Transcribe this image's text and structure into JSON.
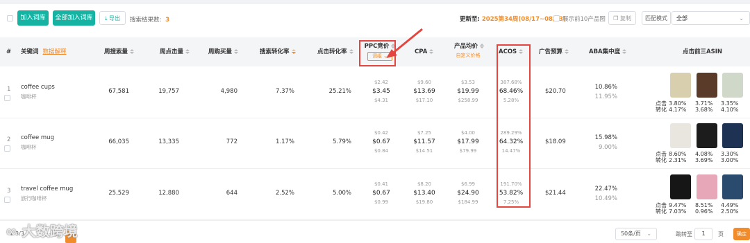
{
  "toolbar": {
    "add_to_lexicon": "加入词库",
    "add_all_to_lexicon": "全部加入词库",
    "export": "导出",
    "results_label": "搜索结果数:",
    "results_count": "3",
    "updated_label": "更新至:",
    "updated_value": "2025第34周(08/17~08/23)",
    "show_top10": "展示前10产品图",
    "copy": "复制",
    "match_mode_label": "匹配模式",
    "match_mode_value": "全部"
  },
  "columns": {
    "index": "#",
    "keyword": "关键词",
    "keyword_link": "数据解释",
    "weekly_searches": "周搜索量",
    "weekly_clicks": "周点击量",
    "weekly_purchases": "周购买量",
    "search_conversion": "搜索转化率",
    "click_conversion": "点击转化率",
    "ppc_bid": "PPC竞价",
    "ppc_sub_button": "词组",
    "cpa": "CPA",
    "avg_price": "产品均价",
    "avg_price_link": "自定义价格",
    "acos": "ACOS",
    "ad_budget": "广告预算",
    "aba_concentration": "ABA集中度",
    "top3_asin": "点击前三ASIN"
  },
  "rows": [
    {
      "index": "1",
      "keyword": "coffee cups",
      "keyword_cn": "咖啡杯",
      "weekly_searches": "67,581",
      "weekly_clicks": "19,757",
      "weekly_purchases": "4,980",
      "search_conversion": "7.37%",
      "click_conversion": "25.21%",
      "ppc": {
        "low": "$2.42",
        "mid": "$3.45",
        "high": "$4.31"
      },
      "cpa": {
        "low": "$9.60",
        "mid": "$13.69",
        "high": "$17.10"
      },
      "price": {
        "low": "$3.53",
        "mid": "$19.99",
        "high": "$258.99"
      },
      "acos": {
        "low": "387.68%",
        "mid": "68.46%",
        "high": "5.28%"
      },
      "ad_budget": "$20.70",
      "aba": {
        "top": "10.86%",
        "bottom": "11.95%"
      },
      "asin_labels": {
        "click": "点击",
        "conv": "转化"
      },
      "asins": [
        {
          "click": "3.80%",
          "conv": "4.17%"
        },
        {
          "click": "3.71%",
          "conv": "3.68%"
        },
        {
          "click": "3.35%",
          "conv": "4.10%"
        }
      ]
    },
    {
      "index": "2",
      "keyword": "coffee mug",
      "keyword_cn": "咖啡杯",
      "weekly_searches": "66,035",
      "weekly_clicks": "13,335",
      "weekly_purchases": "772",
      "search_conversion": "1.17%",
      "click_conversion": "5.79%",
      "ppc": {
        "low": "$0.42",
        "mid": "$0.67",
        "high": "$0.84"
      },
      "cpa": {
        "low": "$7.25",
        "mid": "$11.57",
        "high": "$14.51"
      },
      "price": {
        "low": "$4.00",
        "mid": "$17.99",
        "high": "$79.99"
      },
      "acos": {
        "low": "289.29%",
        "mid": "64.32%",
        "high": "14.47%"
      },
      "ad_budget": "$18.09",
      "aba": {
        "top": "15.98%",
        "bottom": "9.00%"
      },
      "asin_labels": {
        "click": "点击",
        "conv": "转化"
      },
      "asins": [
        {
          "click": "8.60%",
          "conv": "2.31%"
        },
        {
          "click": "4.08%",
          "conv": "3.69%"
        },
        {
          "click": "3.30%",
          "conv": "3.00%"
        }
      ]
    },
    {
      "index": "3",
      "keyword": "travel coffee mug",
      "keyword_cn": "旅行咖啡杯",
      "weekly_searches": "25,529",
      "weekly_clicks": "12,880",
      "weekly_purchases": "644",
      "search_conversion": "2.52%",
      "click_conversion": "5.00%",
      "ppc": {
        "low": "$0.41",
        "mid": "$0.67",
        "high": "$0.99"
      },
      "cpa": {
        "low": "$8.20",
        "mid": "$13.40",
        "high": "$19.80"
      },
      "price": {
        "low": "$6.99",
        "mid": "$24.90",
        "high": "$184.99"
      },
      "acos": {
        "low": "191.70%",
        "mid": "53.82%",
        "high": "7.25%"
      },
      "ad_budget": "$21.44",
      "aba": {
        "top": "22.47%",
        "bottom": "10.49%"
      },
      "asin_labels": {
        "click": "点击",
        "conv": "转化"
      },
      "asins": [
        {
          "click": "9.47%",
          "conv": "7.03%"
        },
        {
          "click": "8.51%",
          "conv": "0.96%"
        },
        {
          "click": "4.49%",
          "conv": "2.50%"
        }
      ]
    }
  ],
  "pagination": {
    "total": "1-3/3",
    "prev": "上一页",
    "page_size": "50条/页",
    "goto_label": "跳转至",
    "goto_value": "1",
    "page_unit": "页",
    "confirm": "确定"
  },
  "watermark": "大数跨境",
  "colors": {
    "accent": "#16b3a3",
    "orange": "#f08c2b",
    "highlight": "#e5453f"
  }
}
